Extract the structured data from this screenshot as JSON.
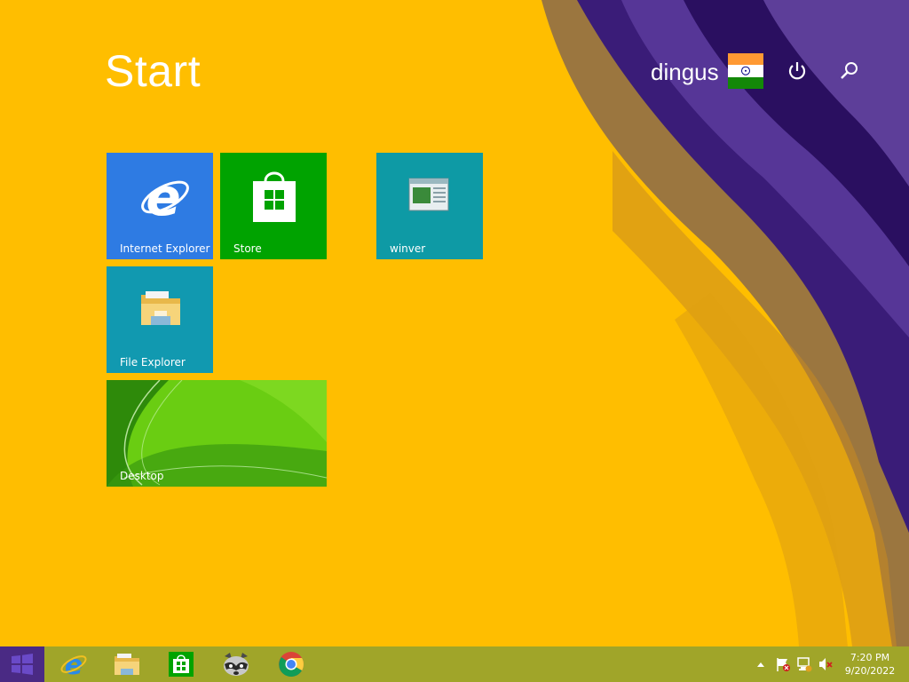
{
  "start": {
    "title": "Start"
  },
  "user": {
    "name": "dingus"
  },
  "tiles": [
    {
      "label": "Internet Explorer",
      "color": "#2e7be3",
      "icon": "internet-explorer-icon"
    },
    {
      "label": "Store",
      "color": "#00a300",
      "icon": "store-icon"
    },
    {
      "label": "winver",
      "color": "#0e9aa5",
      "icon": "winver-window-icon"
    },
    {
      "label": "File Explorer",
      "color": "#1199b0",
      "icon": "folder-icon"
    },
    {
      "label": "Desktop",
      "color": "#5ec70a",
      "icon": "desktop-wallpaper"
    }
  ],
  "taskbar": {
    "color": "#a0a529",
    "pinned": [
      {
        "name": "Internet Explorer",
        "icon": "internet-explorer-icon"
      },
      {
        "name": "File Explorer",
        "icon": "folder-icon"
      },
      {
        "name": "Store",
        "icon": "store-icon"
      },
      {
        "name": "Raccoon app",
        "icon": "raccoon-icon"
      },
      {
        "name": "Google Chrome",
        "icon": "chrome-icon"
      }
    ],
    "tray": [
      "show-hidden-icons-chevron",
      "action-center-flag-icon",
      "network-icon",
      "volume-muted-icon"
    ],
    "clock": {
      "time": "7:20 PM",
      "date": "9/20/2022"
    }
  },
  "colors": {
    "background": "#ffbe00",
    "accent_purple": "#3b1470"
  }
}
